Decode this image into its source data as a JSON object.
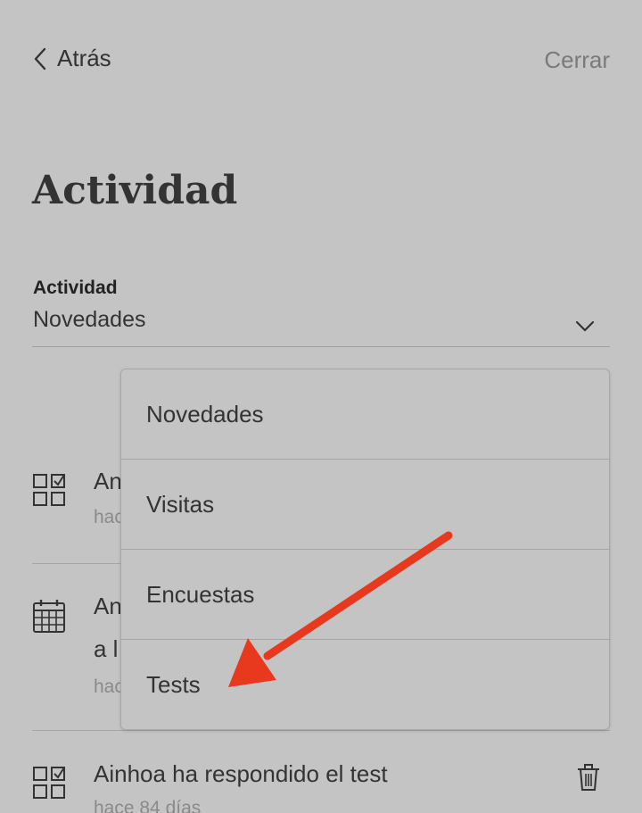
{
  "header": {
    "back_label": "Atrás",
    "close_label": "Cerrar"
  },
  "page": {
    "title": "Actividad"
  },
  "filter": {
    "label": "Actividad",
    "selected": "Novedades",
    "options": [
      "Novedades",
      "Visitas",
      "Encuestas",
      "Tests"
    ]
  },
  "feed": {
    "items": [
      {
        "icon": "test-grid-icon",
        "text": "An",
        "sub": "hac"
      },
      {
        "icon": "calendar-icon",
        "text": "An",
        "text2": "a l",
        "sub": "hac"
      },
      {
        "icon": "test-grid-icon",
        "text": "Ainhoa ha respondido el test",
        "sub": "hace 84 días"
      }
    ]
  },
  "annotation": {
    "arrow_color": "#e8391f"
  }
}
